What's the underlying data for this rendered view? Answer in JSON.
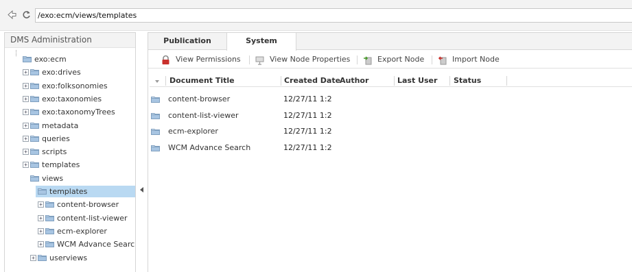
{
  "address": {
    "path": "/exo:ecm/views/templates"
  },
  "left_panel": {
    "title": "DMS Administration",
    "tree": [
      {
        "label": "exo:ecm",
        "expander": ""
      },
      {
        "label": "exo:drives",
        "expander": "+"
      },
      {
        "label": "exo:folksonomies",
        "expander": "+"
      },
      {
        "label": "exo:taxonomies",
        "expander": "+"
      },
      {
        "label": "exo:taxonomyTrees",
        "expander": "+"
      },
      {
        "label": "metadata",
        "expander": "+"
      },
      {
        "label": "queries",
        "expander": "+"
      },
      {
        "label": "scripts",
        "expander": "+"
      },
      {
        "label": "templates",
        "expander": "+"
      },
      {
        "label": "views",
        "expander": ""
      },
      {
        "label": "templates",
        "expander": "",
        "selected": true
      },
      {
        "label": "content-browser",
        "expander": "+"
      },
      {
        "label": "content-list-viewer",
        "expander": "+"
      },
      {
        "label": "ecm-explorer",
        "expander": "+"
      },
      {
        "label": "WCM Advance Search",
        "expander": "+"
      },
      {
        "label": "userviews",
        "expander": "+"
      }
    ]
  },
  "tabs": [
    {
      "label": "Publication",
      "active": false
    },
    {
      "label": "System",
      "active": true
    }
  ],
  "actions": [
    {
      "label": "View Permissions",
      "icon": "lock-icon"
    },
    {
      "label": "View Node Properties",
      "icon": "properties-icon"
    },
    {
      "label": "Export Node",
      "icon": "export-icon"
    },
    {
      "label": "Import Node",
      "icon": "import-icon"
    }
  ],
  "table": {
    "columns": [
      "Document Title",
      "Created Date",
      "Author",
      "Last User",
      "Status"
    ],
    "rows": [
      {
        "title": "content-browser",
        "created": "12/27/11 1:2",
        "author": "",
        "last_user": "",
        "status": ""
      },
      {
        "title": "content-list-viewer",
        "created": "12/27/11 1:2",
        "author": "",
        "last_user": "",
        "status": ""
      },
      {
        "title": "ecm-explorer",
        "created": "12/27/11 1:2",
        "author": "",
        "last_user": "",
        "status": ""
      },
      {
        "title": "WCM Advance Search",
        "created": "12/27/11 1:2",
        "author": "",
        "last_user": "",
        "status": ""
      }
    ]
  },
  "colors": {
    "selection": "#b9d9f2",
    "folder": "#8fb4d6"
  }
}
